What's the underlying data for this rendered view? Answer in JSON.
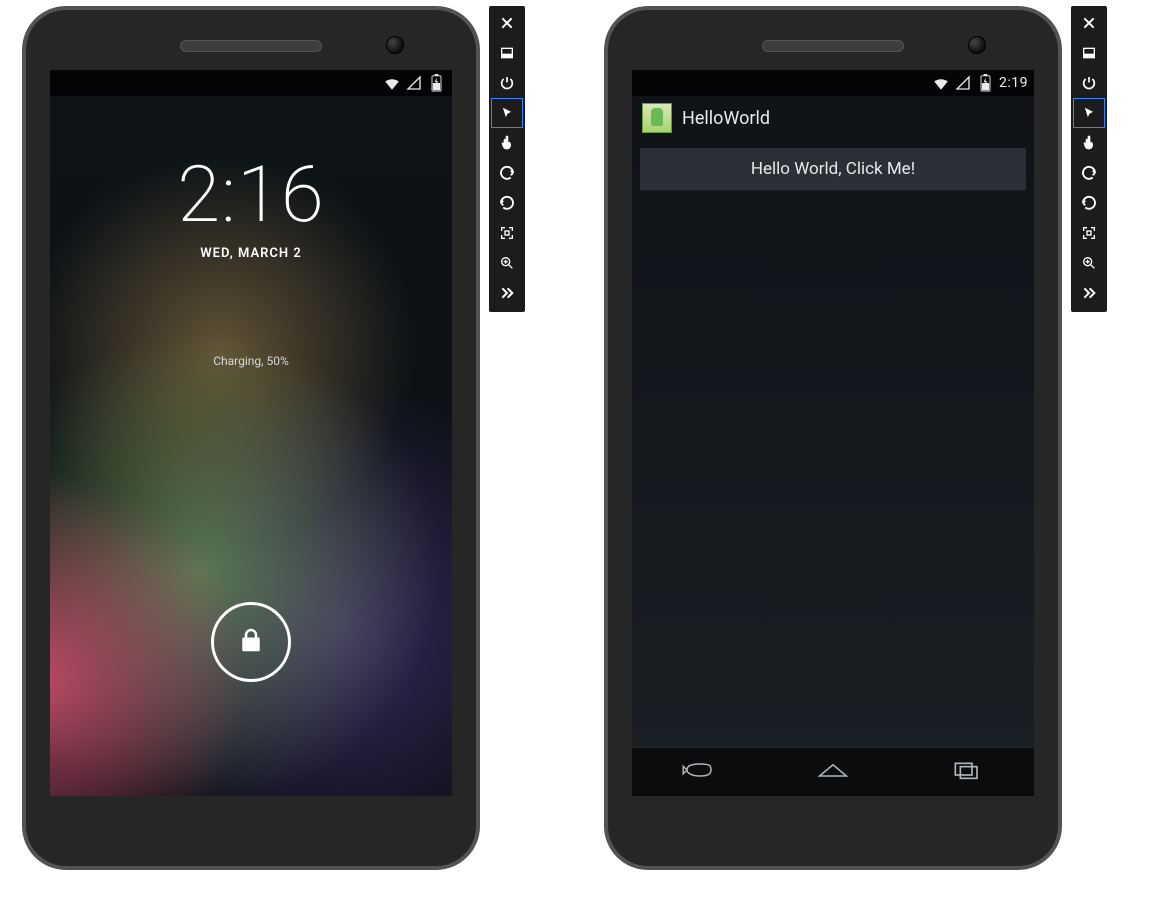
{
  "left": {
    "statusbar": {
      "time": ""
    },
    "lockscreen": {
      "time": "2:16",
      "date": "WED, MARCH 2",
      "charging": "Charging, 50%"
    }
  },
  "right": {
    "statusbar": {
      "time": "2:19"
    },
    "app": {
      "title": "HelloWorld",
      "button_label": "Hello World, Click Me!"
    }
  },
  "toolbar": {
    "buttons": [
      "close",
      "minimize",
      "power",
      "pointer",
      "touch",
      "rotate-left",
      "rotate-right",
      "fit-window",
      "zoom-in",
      "more"
    ]
  }
}
